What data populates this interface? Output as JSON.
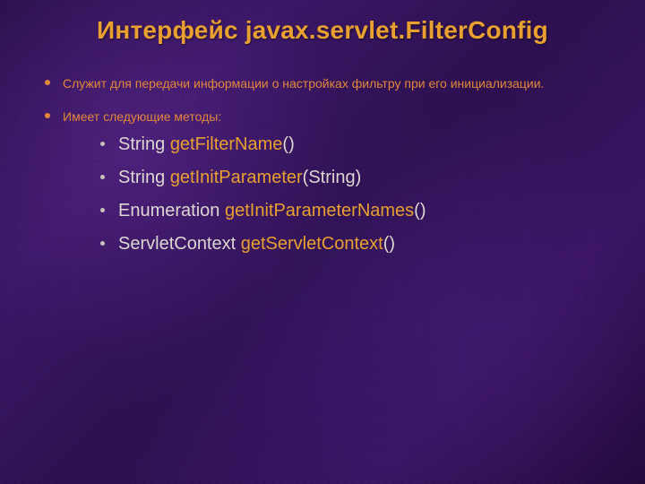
{
  "title": "Интерфейс javax.servlet.FilterConfig",
  "bullets": {
    "intro": "Служит для передачи информации о настройках фильтру при его инициализации.",
    "methods_intro": "Имеет следующие методы:"
  },
  "methods": [
    {
      "return": "String",
      "name": "getFilterName",
      "args": ""
    },
    {
      "return": "String",
      "name": "getInitParameter",
      "args": "String"
    },
    {
      "return": "Enumeration",
      "name": "getInitParameterNames",
      "args": ""
    },
    {
      "return": "ServletContext",
      "name": "getServletContext",
      "args": ""
    }
  ]
}
